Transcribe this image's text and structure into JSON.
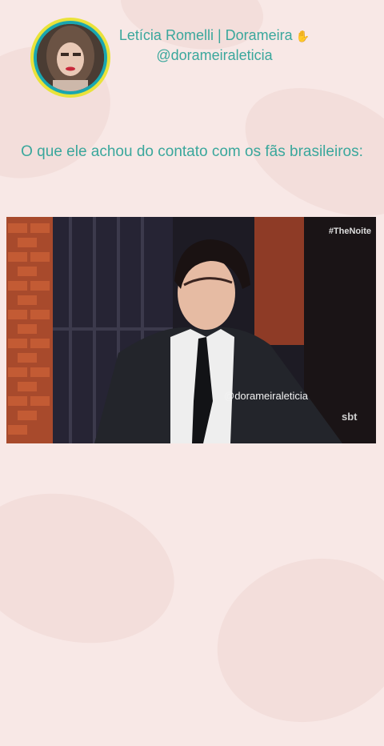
{
  "profile": {
    "name": "Letícia Romelli | Dorameira",
    "handle": "@dorameiraleticia",
    "hand_icon": "raised-hand-icon"
  },
  "caption": "O que ele achou do contato com os fãs brasileiros:",
  "video": {
    "channel_tag": "#TheNoite",
    "watermark": "@dorameiraleticia",
    "network_logo": "sbt"
  },
  "colors": {
    "background": "#f8e8e6",
    "accent_text": "#3aa79c",
    "avatar_ring_outer": "#e9e23a",
    "avatar_ring_inner": "#1aa6b0"
  }
}
